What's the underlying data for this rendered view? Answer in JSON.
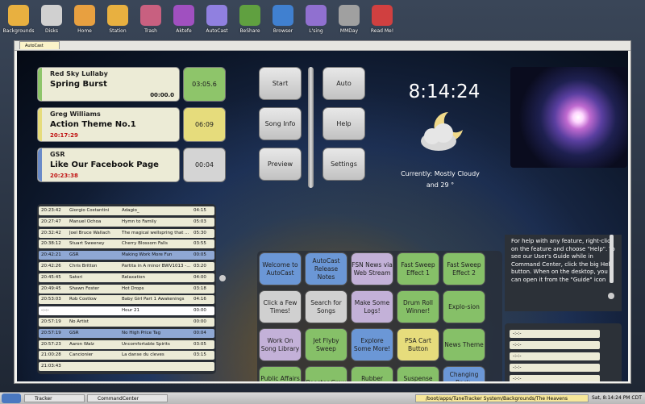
{
  "desktop_icons": [
    {
      "label": "Backgrounds",
      "color": "#e8b040"
    },
    {
      "label": "Disks",
      "color": "#d0d0d0"
    },
    {
      "label": "Home",
      "color": "#e8a040"
    },
    {
      "label": "Station",
      "color": "#e8b040"
    },
    {
      "label": "Trash",
      "color": "#c86080"
    },
    {
      "label": "Aktefe",
      "color": "#a050c0"
    },
    {
      "label": "AutoCast",
      "color": "#9080e0"
    },
    {
      "label": "BeShare",
      "color": "#60a040"
    },
    {
      "label": "Browser",
      "color": "#4080d0"
    },
    {
      "label": "L'sing",
      "color": "#9070d0"
    },
    {
      "label": "MMDay",
      "color": "#a0a0a0"
    },
    {
      "label": "Read Me!",
      "color": "#d04040"
    }
  ],
  "window": {
    "tab": "AutoCast"
  },
  "carts": [
    {
      "artist": "Red Sky Lullaby",
      "title": "Spring Burst",
      "elapsed": "00:00.0",
      "time": "03:05.6",
      "box_color": "#8ec56a",
      "bar_color": "#8ec56a",
      "elapsed_color": "#111"
    },
    {
      "artist": "Greg Williams",
      "title": "Action Theme No.1",
      "elapsed": "20:17:29",
      "time": "06:09",
      "box_color": "#e6dc7c",
      "bar_color": "#e6dc7c",
      "elapsed_color": "#c01010"
    },
    {
      "artist": "GSR",
      "title": "Like Our Facebook Page",
      "elapsed": "20:23:38",
      "time": "00:04",
      "box_color": "#d4d4d4",
      "bar_color": "#6a8bc8",
      "elapsed_color": "#c01010"
    }
  ],
  "playlist": [
    {
      "time": "20:23:42",
      "artist": "Giorgio Costantini",
      "title": "Adagio_",
      "dur": "04:15",
      "color": "#ecebd6"
    },
    {
      "time": "20:27:47",
      "artist": "Manuel Ochoa",
      "title": "Hymn to Family",
      "dur": "05:03",
      "color": "#ecebd6"
    },
    {
      "time": "20:32:42",
      "artist": "Joel Bruce Wallach",
      "title": "The magical wellspring that ...",
      "dur": "05:30",
      "color": "#ecebd6"
    },
    {
      "time": "20:38:12",
      "artist": "Stuart Sweeney",
      "title": "Cherry Blossom Falls",
      "dur": "03:55",
      "color": "#ecebd6"
    },
    {
      "time": "20:42:21",
      "artist": "GSR",
      "title": "Making Work More Fun",
      "dur": "00:05",
      "color": "#8fa8d4"
    },
    {
      "time": "20:42:26",
      "artist": "Chris Britton",
      "title": "Partita in A minor BWV1013 -...",
      "dur": "03:20",
      "color": "#ecebd6"
    },
    {
      "time": "20:45:45",
      "artist": "Satori",
      "title": "Relaxation",
      "dur": "04:00",
      "color": "#ecebd6"
    },
    {
      "time": "20:49:45",
      "artist": "Shawn Foster",
      "title": "Hot Drops",
      "dur": "03:18",
      "color": "#ecebd6"
    },
    {
      "time": "20:53:03",
      "artist": "Rob Costlow",
      "title": "Baby Girl Part 1 Awakenings",
      "dur": "04:16",
      "color": "#ecebd6"
    },
    {
      "time": "-:-:-",
      "artist": "",
      "title": "Hour 21",
      "dur": "00:00",
      "color": "#ffffff"
    },
    {
      "time": "20:57:19",
      "artist": "No Artist",
      "title": "",
      "dur": "00:00",
      "color": "#ecebd6"
    },
    {
      "time": "20:57:19",
      "artist": "GSR",
      "title": "No High Price Tag",
      "dur": "00:04",
      "color": "#8fa8d4"
    },
    {
      "time": "20:57:23",
      "artist": "Aaron Walz",
      "title": "Uncomfortable Spirits",
      "dur": "03:05",
      "color": "#ecebd6"
    },
    {
      "time": "21:00:28",
      "artist": "Cancionier",
      "title": "La danse du cleves",
      "dur": "03:15",
      "color": "#ecebd6"
    },
    {
      "time": "21:03:43",
      "artist": "",
      "title": "",
      "dur": "",
      "color": "#ecebd6"
    }
  ],
  "controls": {
    "start": "Start",
    "song_info": "Song Info",
    "preview": "Preview",
    "auto": "Auto",
    "help": "Help",
    "settings": "Settings"
  },
  "clock": "8:14:24",
  "weather": {
    "line1": "Currently: Mostly Cloudy",
    "line2": "and 29 °"
  },
  "pads": [
    {
      "label": "Welcome to AutoCast",
      "color": "#6b97d6"
    },
    {
      "label": "AutoCast Release Notes",
      "color": "#6b97d6"
    },
    {
      "label": "FSN News via Web Stream",
      "color": "#c3b1d8"
    },
    {
      "label": "Fast Sweep Effect 1",
      "color": "#86c068"
    },
    {
      "label": "Fast Sweep Effect 2",
      "color": "#86c068"
    },
    {
      "label": "Click a Few Times!",
      "color": "#d0d0d0"
    },
    {
      "label": "Search for Songs",
      "color": "#d0d0d0"
    },
    {
      "label": "Make Some Logs!",
      "color": "#c3b1d8"
    },
    {
      "label": "Drum Roll Winner!",
      "color": "#86c068"
    },
    {
      "label": "Explo-sion",
      "color": "#86c068"
    },
    {
      "label": "Work On Song Library",
      "color": "#c3b1d8"
    },
    {
      "label": "Jet Flyby Sweep",
      "color": "#86c068"
    },
    {
      "label": "Explore Some More!",
      "color": "#6b97d6"
    },
    {
      "label": "PSA Cart Button",
      "color": "#e6dc7c"
    },
    {
      "label": "News Theme",
      "color": "#86c068"
    },
    {
      "label": "Public Affairs Theme",
      "color": "#86c068"
    },
    {
      "label": "Rooster Crow",
      "color": "#86c068"
    },
    {
      "label": "Rubber Ducky",
      "color": "#86c068"
    },
    {
      "label": "Suspense Contest Bed",
      "color": "#86c068"
    },
    {
      "label": "Changing Back-Grounds",
      "color": "#6b97d6"
    }
  ],
  "help_text": "For help with any feature, right-click on the feature and choose \"Help\".  To see our User's Guide while in Command Center, click the big Help button. When on the desktop, you can open it from the \"Guide\" icon",
  "queue": [
    "-:-:-",
    "-:-:-",
    "-:-:-",
    "-:-:-",
    "-:-:-",
    "-:-:-",
    "-:-:-",
    "-:-:-"
  ],
  "taskbar": {
    "tracker": "Tracker",
    "command_center": "CommandCenter",
    "path": "/boot/apps/TuneTracker System/Backgrounds/The Heavens",
    "clock": "Sat, 8:14:24 PM CDT"
  }
}
